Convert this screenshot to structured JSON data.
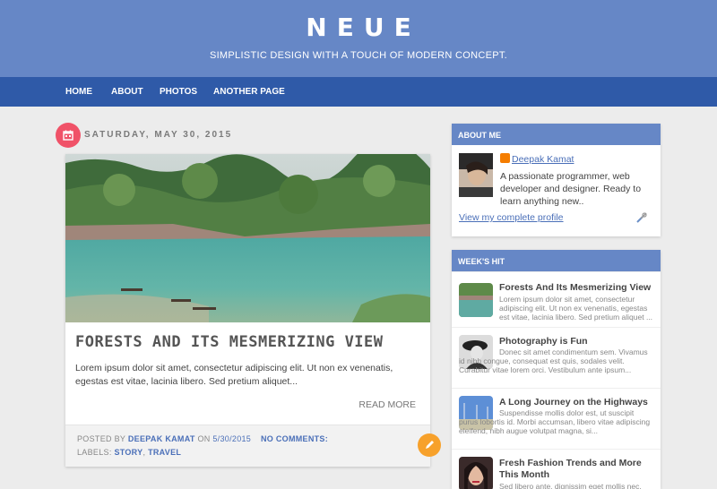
{
  "header": {
    "title": "NEUE",
    "tagline": "SIMPLISTIC DESIGN WITH A TOUCH OF MODERN CONCEPT."
  },
  "nav": {
    "items": [
      "HOME",
      "ABOUT",
      "PHOTOS",
      "ANOTHER PAGE"
    ]
  },
  "post": {
    "date": "SATURDAY, MAY 30, 2015",
    "date_icon": "calendar-icon",
    "title": "FORESTS AND ITS MESMERIZING VIEW",
    "excerpt": "Lorem ipsum dolor sit amet, consectetur adipiscing elit. Ut non ex venenatis, egestas est vitae, lacinia libero. Sed pretium aliquet...",
    "read_more": "READ MORE",
    "posted_by_label": "POSTED BY",
    "author": "DEEPAK KAMAT",
    "on_label": "ON",
    "post_date": "5/30/2015",
    "comments": "NO COMMENTS:",
    "labels_label": "LABELS:",
    "label_1": "STORY",
    "label_sep": ",",
    "label_2": "TRAVEL",
    "edit_icon": "pencil-icon"
  },
  "about": {
    "heading": "ABOUT ME",
    "name": "Deepak Kamat",
    "description": "A passionate programmer, web developer and designer. Ready to learn anything new..",
    "profile_link": "View my complete profile"
  },
  "weeks_hit": {
    "heading": "WEEK'S HIT",
    "items": [
      {
        "title": "Forests And Its Mesmerizing View",
        "snippet": "Lorem ipsum dolor sit amet, consectetur adipiscing elit. Ut non ex venenatis, egestas est vitae, lacinia libero. Sed pretium aliquet ..."
      },
      {
        "title": "Photography is Fun",
        "snippet": "Donec sit amet condimentum sem. Vivamus id nibh congue, consequat est quis, sodales velit. Curabitur vitae lorem orci. Vestibulum ante ipsum..."
      },
      {
        "title": "A Long Journey on the Highways",
        "snippet": "Suspendisse mollis dolor est, ut suscipit purus lobortis id. Morbi accumsan, libero vitae adipiscing eleifend, nibh augue volutpat magna, si..."
      },
      {
        "title": "Fresh Fashion Trends and More This Month",
        "snippet": "Sed libero ante, dignissim eget mollis nec,"
      }
    ]
  },
  "colors": {
    "header": "#6687c6",
    "nav": "#2f5aa8",
    "date_badge": "#f05268",
    "edit_button": "#f7a12b",
    "link": "#4a6fb8"
  }
}
